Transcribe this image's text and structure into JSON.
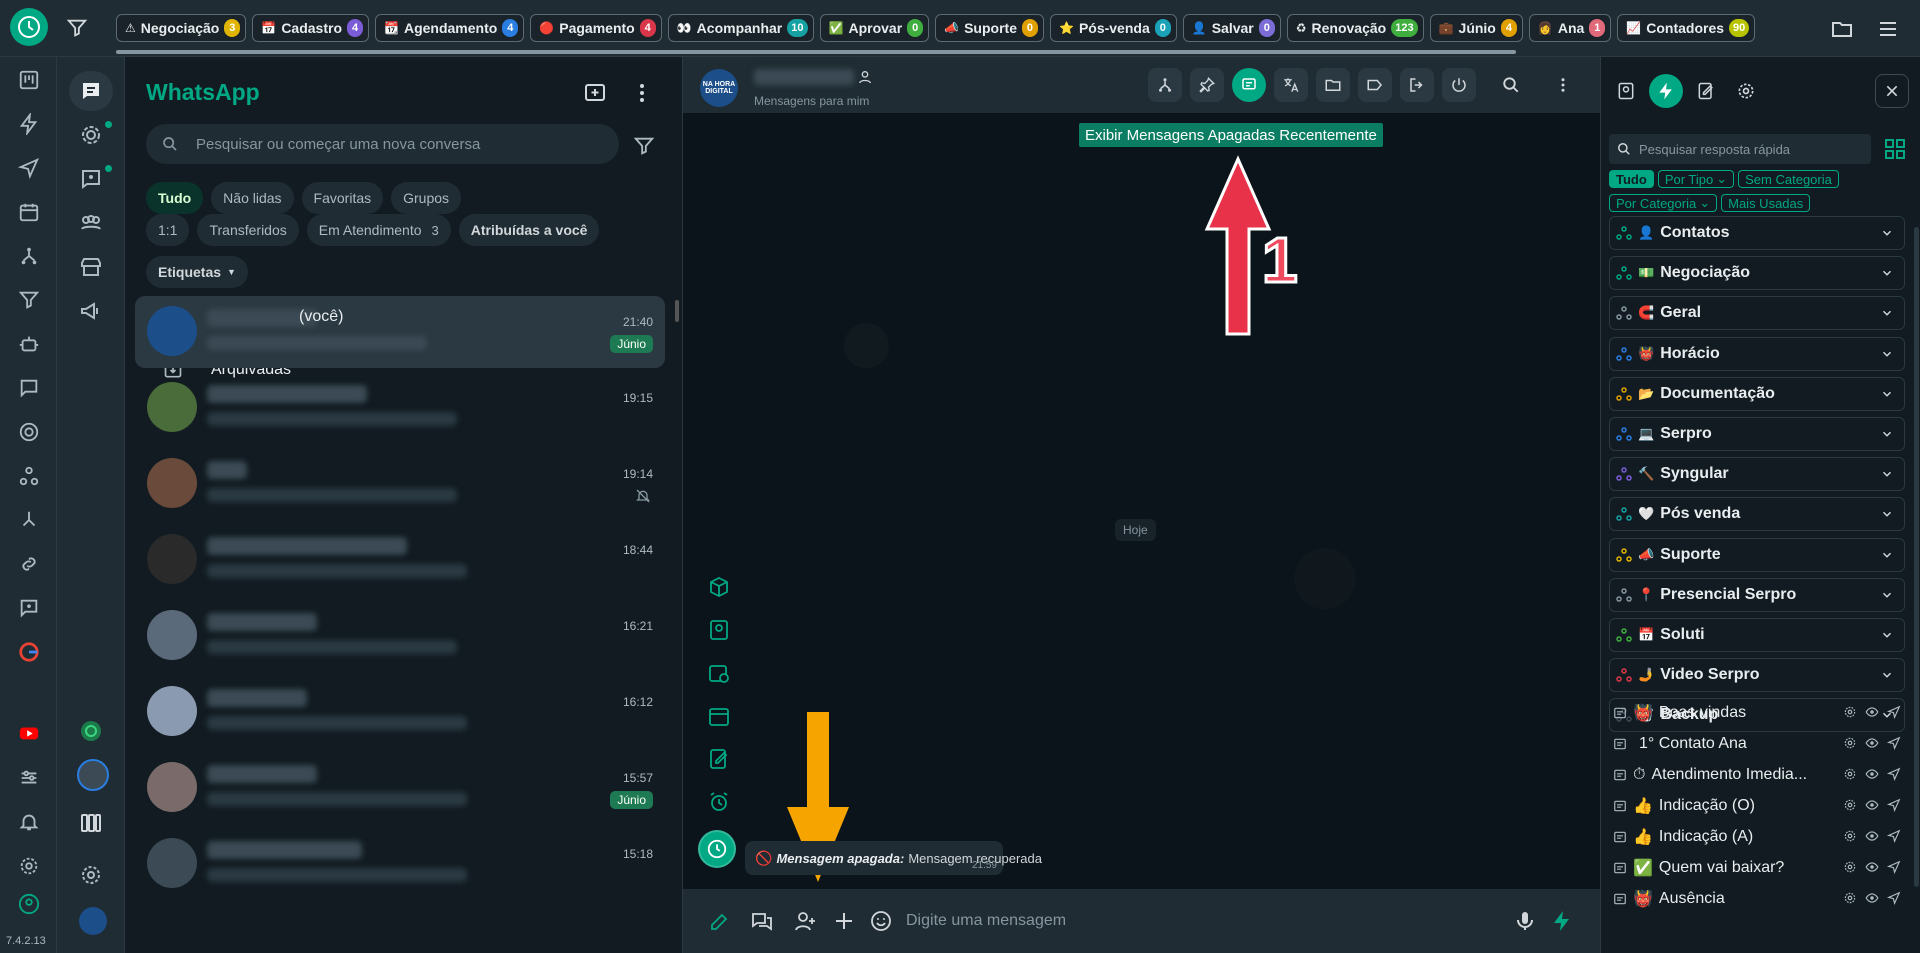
{
  "topbar": {
    "tags": [
      {
        "icon": "⚠",
        "label": "Negociação",
        "count": "3",
        "color": "#e0b400"
      },
      {
        "icon": "📅",
        "label": "Cadastro",
        "count": "4",
        "color": "#7c5cd6"
      },
      {
        "icon": "📆",
        "label": "Agendamento",
        "count": "4",
        "color": "#2a7de1"
      },
      {
        "icon": "🔴",
        "label": "Pagamento",
        "count": "4",
        "color": "#d9364a"
      },
      {
        "icon": "👀",
        "label": "Acompanhar",
        "count": "10",
        "color": "#16a2a2"
      },
      {
        "icon": "✅",
        "label": "Aprovar",
        "count": "0",
        "color": "#3fae3f"
      },
      {
        "icon": "📣",
        "label": "Suporte",
        "count": "0",
        "color": "#e0a000"
      },
      {
        "icon": "⭐",
        "label": "Pós-venda",
        "count": "0",
        "color": "#1aa3b8"
      },
      {
        "icon": "👤",
        "label": "Salvar",
        "count": "0",
        "color": "#7c6cd6"
      },
      {
        "icon": "♻",
        "label": "Renovação",
        "count": "123",
        "color": "#3fae3f"
      },
      {
        "icon": "💼",
        "label": "Júnio",
        "count": "4",
        "color": "#e0a000"
      },
      {
        "icon": "👩",
        "label": "Ana",
        "count": "1",
        "color": "#e06a7a"
      },
      {
        "icon": "📈",
        "label": "Contadores",
        "count": "90",
        "color": "#b8c400"
      }
    ]
  },
  "rail": {
    "version": "7.4.2.13"
  },
  "chatlist": {
    "title": "WhatsApp",
    "search_placeholder": "Pesquisar ou começar uma nova conversa",
    "chips_row1": [
      "Tudo",
      "Não lidas",
      "Favoritas",
      "Grupos"
    ],
    "chips_row2": [
      {
        "label": "1:1",
        "count": ""
      },
      {
        "label": "Transferidos",
        "count": ""
      },
      {
        "label": "Em Atendimento",
        "count": "3"
      },
      {
        "label": "Atribuídas a você",
        "count": ""
      }
    ],
    "etiquetas": "Etiquetas",
    "archived": "Arquivadas",
    "you_label": "(você)",
    "chats": [
      {
        "time": "21:40",
        "label": "Júnio"
      },
      {
        "time": "19:15",
        "label": ""
      },
      {
        "time": "19:14",
        "label": ""
      },
      {
        "time": "18:44",
        "label": ""
      },
      {
        "time": "16:21",
        "label": ""
      },
      {
        "time": "16:12",
        "label": ""
      },
      {
        "time": "15:57",
        "label": "Júnio"
      },
      {
        "time": "15:18",
        "label": ""
      }
    ]
  },
  "conversation": {
    "subtitle": "Mensagens para mim",
    "avatar_text": "NA HORA DIGITAL",
    "tooltip": "Exibir Mensagens Apagadas Recentemente",
    "date_divider": "Hoje",
    "annotation_number": "1",
    "message": {
      "deleted_label": "Mensagem apagada:",
      "text": "Mensagem recuperada",
      "time": "21:59"
    },
    "composer_placeholder": "Digite uma mensagem"
  },
  "right_panel": {
    "search_placeholder": "Pesquisar resposta rápida",
    "chips_row1": [
      "Tudo",
      "Por Tipo",
      "Sem Categoria"
    ],
    "chips_row2": [
      "Por Categoria",
      "Mais Usadas"
    ],
    "categories": [
      {
        "icon": "👤",
        "label": "Contatos",
        "color": "#00a884"
      },
      {
        "icon": "💵",
        "label": "Negociação",
        "color": "#00a884"
      },
      {
        "icon": "🧲",
        "label": "Geral",
        "color": "#8696a0"
      },
      {
        "icon": "👹",
        "label": "Horácio",
        "color": "#2a7de1"
      },
      {
        "icon": "📂",
        "label": "Documentação",
        "color": "#e0a000"
      },
      {
        "icon": "💻",
        "label": "Serpro",
        "color": "#2a7de1"
      },
      {
        "icon": "🔨",
        "label": "Syngular",
        "color": "#7c5cd6"
      },
      {
        "icon": "🤍",
        "label": "Pós venda",
        "color": "#16a2a2"
      },
      {
        "icon": "📣",
        "label": "Suporte",
        "color": "#e0b400"
      },
      {
        "icon": "📍",
        "label": "Presencial Serpro",
        "color": "#8696a0"
      },
      {
        "icon": "📅",
        "label": "Soluti",
        "color": "#3fae3f"
      },
      {
        "icon": "🤳",
        "label": "Video Serpro",
        "color": "#d9364a"
      },
      {
        "icon": "🗑",
        "label": "Backup",
        "color": "#3b4a54"
      }
    ],
    "quick_replies": [
      {
        "icon": "👹",
        "label": "Boas vindas"
      },
      {
        "icon": "",
        "label": "1° Contato Ana"
      },
      {
        "icon": "⏱",
        "label": "Atendimento Imedia..."
      },
      {
        "icon": "👍",
        "label": "Indicação (O)"
      },
      {
        "icon": "👍",
        "label": "Indicação (A)"
      },
      {
        "icon": "✅",
        "label": "Quem vai baixar?"
      },
      {
        "icon": "👹",
        "label": "Ausência"
      }
    ]
  }
}
